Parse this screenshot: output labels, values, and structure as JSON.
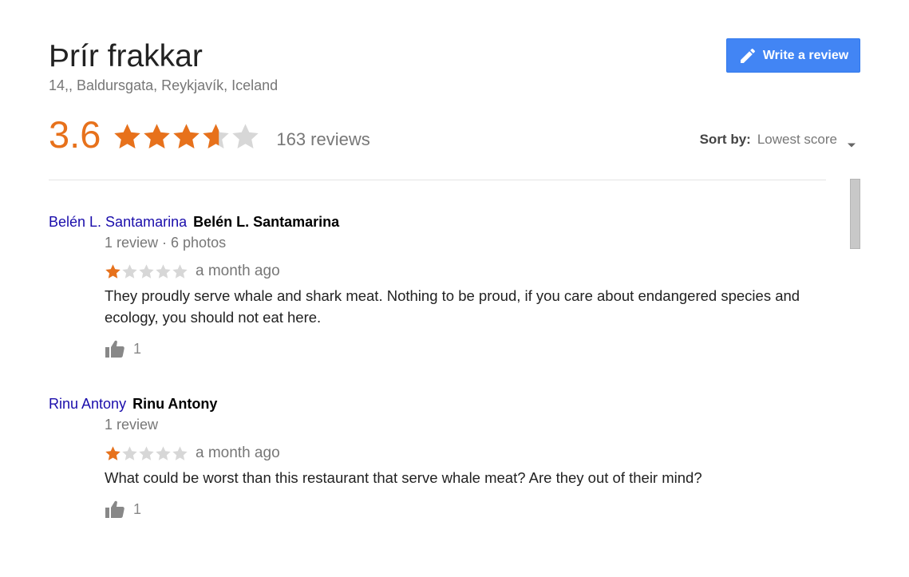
{
  "place": {
    "title": "Þrír frakkar",
    "address": "14,, Baldursgata, Reykjavík, Iceland"
  },
  "write_review": {
    "label": "Write a review",
    "icon": "pencil-icon",
    "color": "#4285f4"
  },
  "rating": {
    "score": "3.6",
    "stars": 3.6,
    "count_label": "163 reviews",
    "star_color": "#e7711b",
    "empty_star_color": "#d7d7d7"
  },
  "sort": {
    "label": "Sort by:",
    "value": "Lowest score",
    "icon": "caret-down-icon"
  },
  "reviews": [
    {
      "author_link": "Belén L. Santamarina",
      "author_name": "Belén L. Santamarina",
      "meta": "1 review · 6 photos",
      "stars": 1,
      "date": "a month ago",
      "text": "They proudly serve whale and shark meat. Nothing to be proud, if you care about endangered species and ecology, you should not eat here.",
      "likes": "1",
      "like_icon": "thumbs-up-icon"
    },
    {
      "author_link": "Rinu Antony",
      "author_name": "Rinu Antony",
      "meta": "1 review",
      "stars": 1,
      "date": "a month ago",
      "text": "What could be worst than this restaurant that serve whale meat? Are they out of their mind?",
      "likes": "1",
      "like_icon": "thumbs-up-icon"
    }
  ]
}
